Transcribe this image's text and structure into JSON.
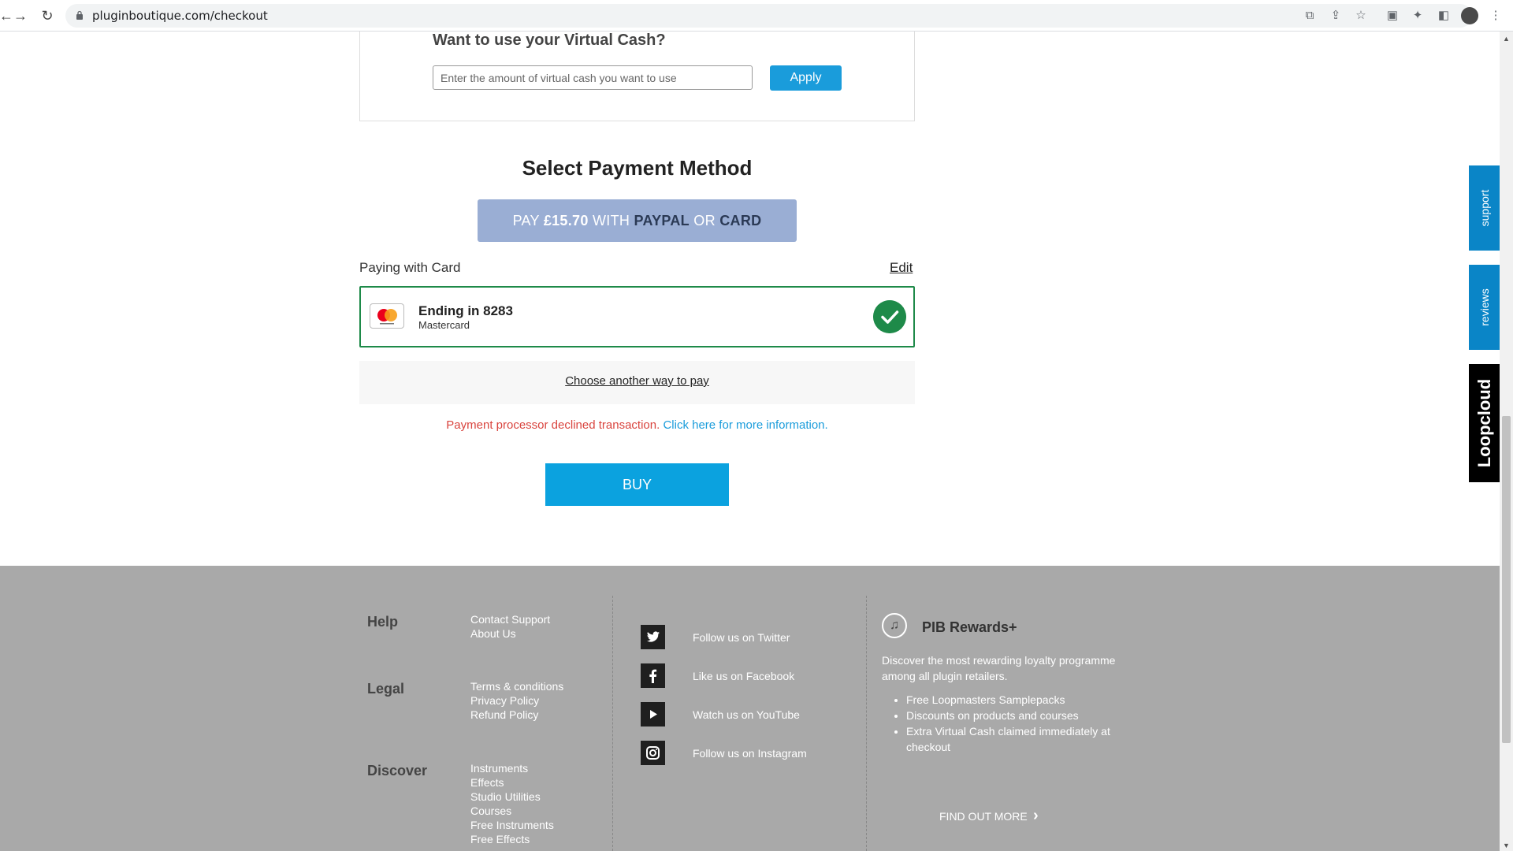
{
  "browser": {
    "url": "pluginboutique.com/checkout",
    "back_icon": "back-arrow-icon",
    "forward_icon": "forward-arrow-icon",
    "reload_icon": "reload-icon"
  },
  "virtual_cash": {
    "title": "Want to use your Virtual Cash?",
    "placeholder": "Enter the amount of virtual cash you want to use",
    "value": "",
    "apply_label": "Apply"
  },
  "payment": {
    "title": "Select Payment Method",
    "pay_prefix": "PAY",
    "pay_amount": "£15.70",
    "pay_with": "WITH",
    "pay_paypal": "PAYPAL",
    "pay_or": "OR",
    "pay_card": "CARD",
    "paying_with": "Paying with Card",
    "edit": "Edit",
    "card_ending": "Ending in 8283",
    "card_brand": "Mastercard",
    "choose_another": "Choose another way to pay",
    "error": "Payment processor declined transaction.",
    "error_link": "Click here for more information.",
    "buy": "BUY"
  },
  "side_tabs": {
    "support": "support",
    "reviews": "reviews",
    "loopcloud": "Loopcloud"
  },
  "footer": {
    "help": {
      "heading": "Help",
      "links": [
        "Contact Support",
        "About Us"
      ]
    },
    "legal": {
      "heading": "Legal",
      "links": [
        "Terms & conditions",
        "Privacy Policy",
        "Refund Policy"
      ]
    },
    "discover": {
      "heading": "Discover",
      "links": [
        "Instruments",
        "Effects",
        "Studio Utilities",
        "Courses",
        "Free Instruments",
        "Free Effects"
      ]
    },
    "social": [
      {
        "label": "Follow us on Twitter",
        "icon": "twitter-icon"
      },
      {
        "label": "Like us on Facebook",
        "icon": "facebook-icon"
      },
      {
        "label": "Watch us on YouTube",
        "icon": "youtube-icon"
      },
      {
        "label": "Follow us on Instagram",
        "icon": "instagram-icon"
      }
    ],
    "rewards": {
      "title": "PIB Rewards+",
      "description": "Discover the most rewarding loyalty programme among all plugin retailers.",
      "benefits": [
        "Free Loopmasters Samplepacks",
        "Discounts on products and courses",
        "Extra Virtual Cash claimed immediately at checkout"
      ],
      "cta": "FIND OUT MORE"
    }
  },
  "colors": {
    "accent": "#1a9cdb",
    "success": "#1e8a49",
    "error": "#d9443e",
    "footer_bg": "#a9a9a9"
  }
}
